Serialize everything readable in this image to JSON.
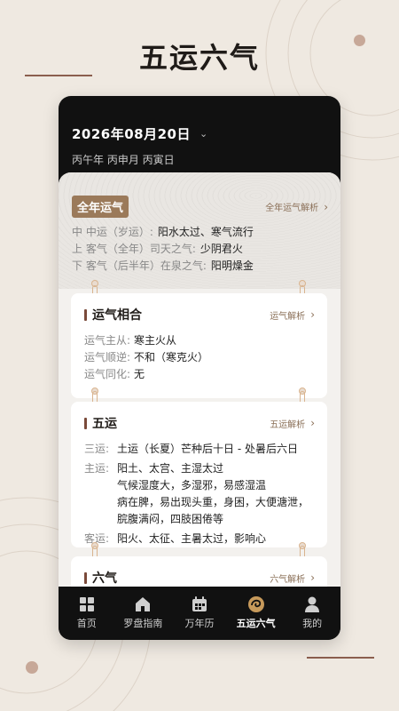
{
  "hero_title": "五运六气",
  "header": {
    "date": "2026年08月20日",
    "ganzhi": "丙午年 丙申月 丙寅日"
  },
  "annual": {
    "badge": "全年运气",
    "link": "全年运气解析",
    "lines": [
      {
        "label": "中 中运（岁运）:",
        "value": "阳水太过、寒气流行"
      },
      {
        "label": "上 客气（全年）司天之气:",
        "value": "少阴君火"
      },
      {
        "label": "下 客气（后半年）在泉之气:",
        "value": "阳明燥金"
      }
    ]
  },
  "yunqi": {
    "title": "运气相合",
    "link": "运气解析",
    "rows": [
      {
        "k": "运气主从:",
        "v": "寒主火从"
      },
      {
        "k": "运气顺逆:",
        "v": "不和（寒克火）"
      },
      {
        "k": "运气同化:",
        "v": "无"
      }
    ]
  },
  "wuyun": {
    "title": "五运",
    "link": "五运解析",
    "san_label": "三运:",
    "san_value": "土运（长夏）芒种后十日 - 处暑后六日",
    "zhu_label": "主运:",
    "zhu_lines": [
      "阳土、太宫、主湿太过",
      "气候湿度大，多湿邪，易感湿温",
      "病在脾，易出现头重，身困，大便溏泄，",
      "脘腹满闷，四肢困倦等"
    ],
    "ke_label": "客运:",
    "ke_value": "阳火、太征、主暑太过，影响心"
  },
  "liuqi": {
    "title": "六气",
    "link": "六气解析"
  },
  "tabs": [
    {
      "label": "首页",
      "icon": "grid-icon"
    },
    {
      "label": "罗盘指南",
      "icon": "home-icon"
    },
    {
      "label": "万年历",
      "icon": "calendar-icon"
    },
    {
      "label": "五运六气",
      "icon": "swirl-icon"
    },
    {
      "label": "我的",
      "icon": "person-icon"
    }
  ],
  "colors": {
    "accent": "#9b7a5a",
    "background": "#efe9e1",
    "dark": "#111111"
  }
}
